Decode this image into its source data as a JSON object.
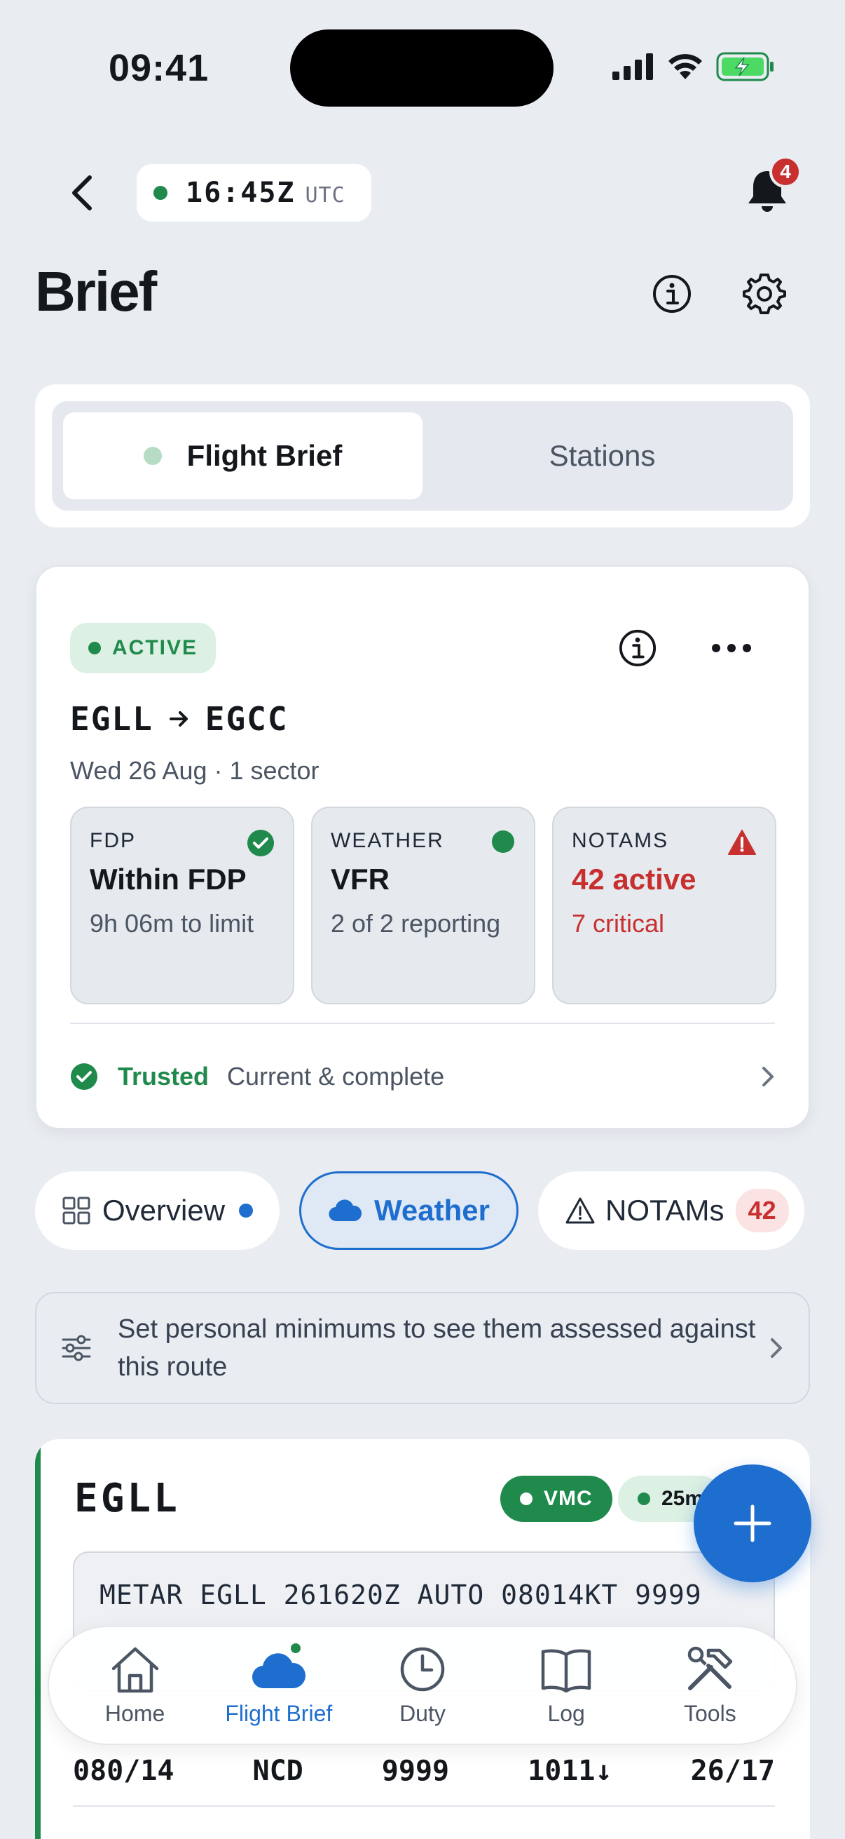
{
  "status_bar": {
    "time": "09:41"
  },
  "header": {
    "utc_time": "16:45Z",
    "utc_label": "UTC",
    "notification_count": "4",
    "title": "Brief"
  },
  "segments": {
    "items": [
      "Flight Brief",
      "Stations"
    ],
    "selected": "Flight Brief"
  },
  "brief": {
    "status": "ACTIVE",
    "origin": "EGLL",
    "destination": "EGCC",
    "subtitle": "Wed 26 Aug · 1 sector",
    "tiles": [
      {
        "caption": "FDP",
        "main": "Within FDP",
        "sub": "9h 06m to limit",
        "icon": "check-circle-icon"
      },
      {
        "caption": "WEATHER",
        "main": "VFR",
        "sub": "2 of 2 reporting",
        "icon": "green-dot-icon"
      },
      {
        "caption": "NOTAMS",
        "main": "42 active",
        "sub": "7 critical",
        "icon": "warning-icon"
      }
    ],
    "trust_label": "Trusted",
    "trust_detail": "Current & complete"
  },
  "chips": {
    "overview": "Overview",
    "weather": "Weather",
    "notams": "NOTAMs",
    "notams_count": "42"
  },
  "minimums_prompt": "Set personal minimums to see them assessed against this route",
  "station": {
    "id": "EGLL",
    "condition": "VMC",
    "age": "25m",
    "metar": "METAR EGLL 261620Z AUTO 08014KT 9999",
    "wind": "080/14",
    "cloud": "NCD",
    "visibility": "9999",
    "pressure": "1011↓",
    "temp_dew": "26/17"
  },
  "tabbar": {
    "items": [
      {
        "label": "Home",
        "icon": "home-icon"
      },
      {
        "label": "Flight Brief",
        "icon": "cloud-icon"
      },
      {
        "label": "Duty",
        "icon": "clock-icon"
      },
      {
        "label": "Log",
        "icon": "book-icon"
      },
      {
        "label": "Tools",
        "icon": "tools-icon"
      }
    ],
    "selected": "Flight Brief"
  },
  "colors": {
    "accent": "#1e6ecf",
    "success": "#1f8a4c",
    "danger": "#c8302f",
    "background": "#e9ecf1"
  }
}
